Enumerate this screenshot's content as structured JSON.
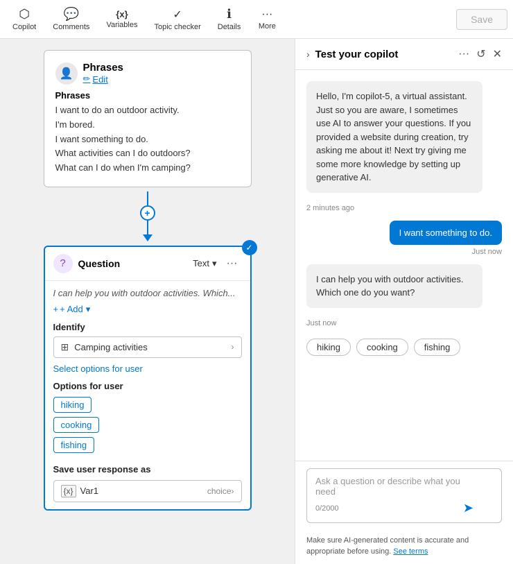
{
  "toolbar": {
    "items": [
      {
        "id": "copilot",
        "label": "Copilot",
        "icon": "⬡"
      },
      {
        "id": "comments",
        "label": "Comments",
        "icon": "💬"
      },
      {
        "id": "variables",
        "label": "Variables",
        "icon": "{x}"
      },
      {
        "id": "topic-checker",
        "label": "Topic checker",
        "icon": "✓"
      },
      {
        "id": "details",
        "label": "Details",
        "icon": "ℹ"
      },
      {
        "id": "more",
        "label": "More",
        "icon": "···"
      }
    ],
    "save_label": "Save"
  },
  "phrases_card": {
    "title": "Phrases",
    "edit_label": "Edit",
    "body_title": "Phrases",
    "lines": [
      "I want to do an outdoor activity.",
      "I'm bored.",
      "I want something to do.",
      "What activities can I do outdoors?",
      "What can I do when I'm camping?"
    ]
  },
  "question_card": {
    "title": "Question",
    "type": "Text",
    "preview_text": "I can help you with outdoor activities. Which...",
    "add_label": "+ Add",
    "identify_label": "Identify",
    "identify_icon": "⊞",
    "identify_text": "Camping activities",
    "select_link": "Select options for user",
    "options_label": "Options for user",
    "options": [
      "hiking",
      "cooking",
      "fishing"
    ],
    "save_label": "Save user response as",
    "var_name": "Var1",
    "var_type": "choice"
  },
  "right_panel": {
    "title": "Test your copilot",
    "bot_intro": "Hello, I'm copilot-5, a virtual assistant. Just so you are aware, I sometimes use AI to answer your questions. If you provided a website during creation, try asking me about it! Next try giving me some more knowledge by setting up generative AI.",
    "bot_intro_time": "2 minutes ago",
    "user_message": "I want something to do.",
    "user_message_time": "Just now",
    "bot_reply": "I can help you with outdoor activities. Which one do you want?",
    "bot_reply_time": "Just now",
    "option_btns": [
      "hiking",
      "cooking",
      "fishing"
    ],
    "input_placeholder": "Ask a question or describe what you need",
    "char_count": "0/2000",
    "disclaimer": "Make sure AI-generated content is accurate and appropriate before using.",
    "disclaimer_link": "See terms"
  }
}
